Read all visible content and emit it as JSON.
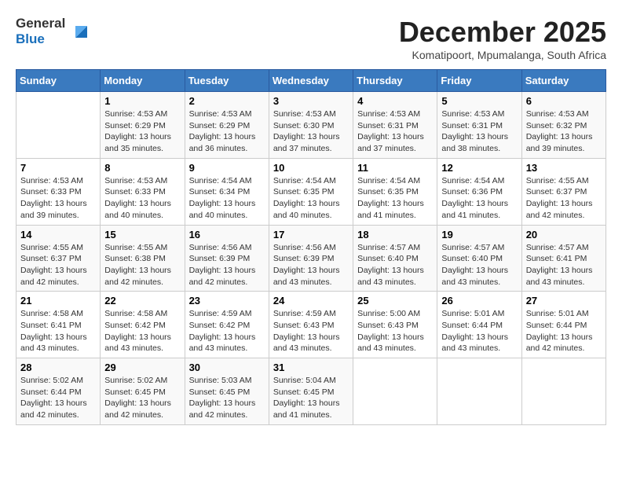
{
  "header": {
    "logo_line1": "General",
    "logo_line2": "Blue",
    "month": "December 2025",
    "location": "Komatipoort, Mpumalanga, South Africa"
  },
  "days_of_week": [
    "Sunday",
    "Monday",
    "Tuesday",
    "Wednesday",
    "Thursday",
    "Friday",
    "Saturday"
  ],
  "weeks": [
    [
      {
        "day": "",
        "info": ""
      },
      {
        "day": "1",
        "info": "Sunrise: 4:53 AM\nSunset: 6:29 PM\nDaylight: 13 hours\nand 35 minutes."
      },
      {
        "day": "2",
        "info": "Sunrise: 4:53 AM\nSunset: 6:29 PM\nDaylight: 13 hours\nand 36 minutes."
      },
      {
        "day": "3",
        "info": "Sunrise: 4:53 AM\nSunset: 6:30 PM\nDaylight: 13 hours\nand 37 minutes."
      },
      {
        "day": "4",
        "info": "Sunrise: 4:53 AM\nSunset: 6:31 PM\nDaylight: 13 hours\nand 37 minutes."
      },
      {
        "day": "5",
        "info": "Sunrise: 4:53 AM\nSunset: 6:31 PM\nDaylight: 13 hours\nand 38 minutes."
      },
      {
        "day": "6",
        "info": "Sunrise: 4:53 AM\nSunset: 6:32 PM\nDaylight: 13 hours\nand 39 minutes."
      }
    ],
    [
      {
        "day": "7",
        "info": "Sunrise: 4:53 AM\nSunset: 6:33 PM\nDaylight: 13 hours\nand 39 minutes."
      },
      {
        "day": "8",
        "info": "Sunrise: 4:53 AM\nSunset: 6:33 PM\nDaylight: 13 hours\nand 40 minutes."
      },
      {
        "day": "9",
        "info": "Sunrise: 4:54 AM\nSunset: 6:34 PM\nDaylight: 13 hours\nand 40 minutes."
      },
      {
        "day": "10",
        "info": "Sunrise: 4:54 AM\nSunset: 6:35 PM\nDaylight: 13 hours\nand 40 minutes."
      },
      {
        "day": "11",
        "info": "Sunrise: 4:54 AM\nSunset: 6:35 PM\nDaylight: 13 hours\nand 41 minutes."
      },
      {
        "day": "12",
        "info": "Sunrise: 4:54 AM\nSunset: 6:36 PM\nDaylight: 13 hours\nand 41 minutes."
      },
      {
        "day": "13",
        "info": "Sunrise: 4:55 AM\nSunset: 6:37 PM\nDaylight: 13 hours\nand 42 minutes."
      }
    ],
    [
      {
        "day": "14",
        "info": "Sunrise: 4:55 AM\nSunset: 6:37 PM\nDaylight: 13 hours\nand 42 minutes."
      },
      {
        "day": "15",
        "info": "Sunrise: 4:55 AM\nSunset: 6:38 PM\nDaylight: 13 hours\nand 42 minutes."
      },
      {
        "day": "16",
        "info": "Sunrise: 4:56 AM\nSunset: 6:39 PM\nDaylight: 13 hours\nand 42 minutes."
      },
      {
        "day": "17",
        "info": "Sunrise: 4:56 AM\nSunset: 6:39 PM\nDaylight: 13 hours\nand 43 minutes."
      },
      {
        "day": "18",
        "info": "Sunrise: 4:57 AM\nSunset: 6:40 PM\nDaylight: 13 hours\nand 43 minutes."
      },
      {
        "day": "19",
        "info": "Sunrise: 4:57 AM\nSunset: 6:40 PM\nDaylight: 13 hours\nand 43 minutes."
      },
      {
        "day": "20",
        "info": "Sunrise: 4:57 AM\nSunset: 6:41 PM\nDaylight: 13 hours\nand 43 minutes."
      }
    ],
    [
      {
        "day": "21",
        "info": "Sunrise: 4:58 AM\nSunset: 6:41 PM\nDaylight: 13 hours\nand 43 minutes."
      },
      {
        "day": "22",
        "info": "Sunrise: 4:58 AM\nSunset: 6:42 PM\nDaylight: 13 hours\nand 43 minutes."
      },
      {
        "day": "23",
        "info": "Sunrise: 4:59 AM\nSunset: 6:42 PM\nDaylight: 13 hours\nand 43 minutes."
      },
      {
        "day": "24",
        "info": "Sunrise: 4:59 AM\nSunset: 6:43 PM\nDaylight: 13 hours\nand 43 minutes."
      },
      {
        "day": "25",
        "info": "Sunrise: 5:00 AM\nSunset: 6:43 PM\nDaylight: 13 hours\nand 43 minutes."
      },
      {
        "day": "26",
        "info": "Sunrise: 5:01 AM\nSunset: 6:44 PM\nDaylight: 13 hours\nand 43 minutes."
      },
      {
        "day": "27",
        "info": "Sunrise: 5:01 AM\nSunset: 6:44 PM\nDaylight: 13 hours\nand 42 minutes."
      }
    ],
    [
      {
        "day": "28",
        "info": "Sunrise: 5:02 AM\nSunset: 6:44 PM\nDaylight: 13 hours\nand 42 minutes."
      },
      {
        "day": "29",
        "info": "Sunrise: 5:02 AM\nSunset: 6:45 PM\nDaylight: 13 hours\nand 42 minutes."
      },
      {
        "day": "30",
        "info": "Sunrise: 5:03 AM\nSunset: 6:45 PM\nDaylight: 13 hours\nand 42 minutes."
      },
      {
        "day": "31",
        "info": "Sunrise: 5:04 AM\nSunset: 6:45 PM\nDaylight: 13 hours\nand 41 minutes."
      },
      {
        "day": "",
        "info": ""
      },
      {
        "day": "",
        "info": ""
      },
      {
        "day": "",
        "info": ""
      }
    ]
  ]
}
